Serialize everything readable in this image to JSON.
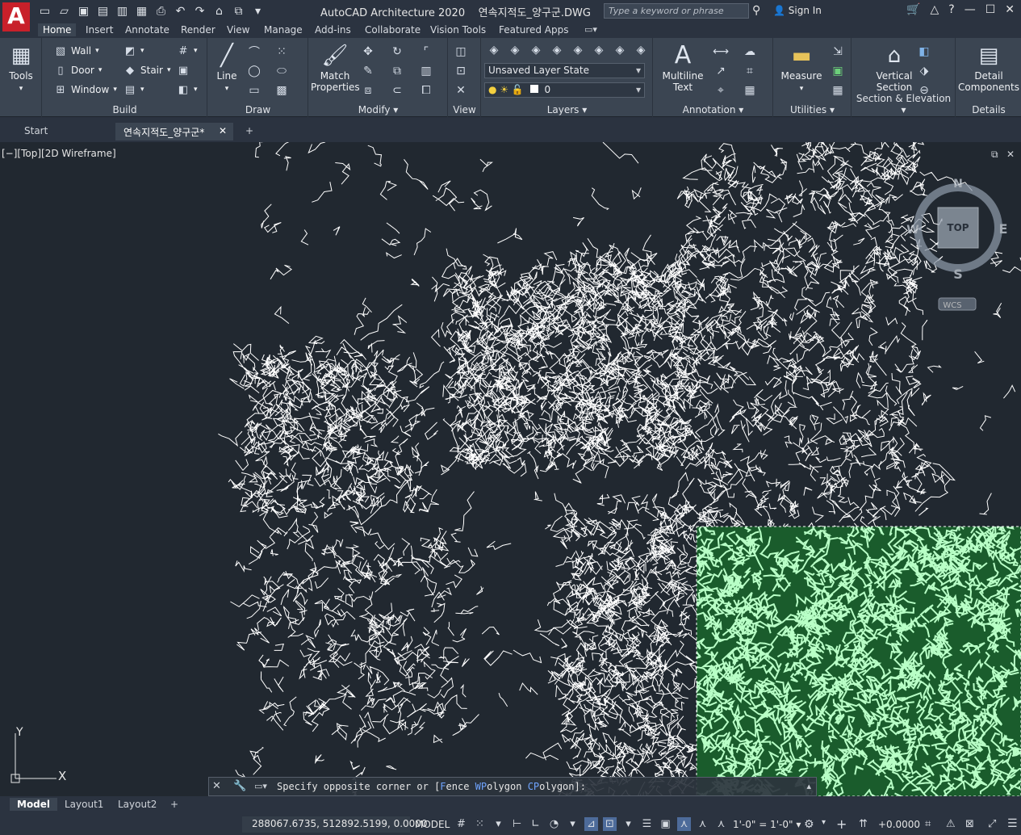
{
  "app": {
    "title": "AutoCAD Architecture 2020",
    "file": "연속지적도_양구군.DWG",
    "search_placeholder": "Type a keyword or phrase",
    "sign_in": "Sign In"
  },
  "ribbon_tabs": [
    "Home",
    "Insert",
    "Annotate",
    "Render",
    "View",
    "Manage",
    "Add-ins",
    "Collaborate",
    "Vision Tools",
    "Featured Apps"
  ],
  "panels": {
    "tools": {
      "label": "Tools"
    },
    "build": {
      "label": "Build",
      "wall": "Wall",
      "door": "Door",
      "window": "Window",
      "stair": "Stair"
    },
    "draw": {
      "label": "Draw",
      "line": "Line"
    },
    "modify": {
      "label": "Modify",
      "match": "Match",
      "properties": "Properties"
    },
    "view": {
      "label": "View"
    },
    "layers": {
      "label": "Layers",
      "state": "Unsaved Layer State",
      "current": "0"
    },
    "annotation": {
      "label": "Annotation",
      "multiline": "Multiline",
      "text": "Text"
    },
    "utilities": {
      "label": "Utilities",
      "measure": "Measure"
    },
    "section": {
      "label": "Section & Elevation",
      "vertical": "Vertical",
      "section": "Section"
    },
    "details": {
      "label": "Details",
      "detail": "Detail",
      "components": "Components"
    }
  },
  "doc_tabs": {
    "start": "Start",
    "active": "연속지적도_양구군*"
  },
  "viewport": {
    "label": "[−][Top][2D Wireframe]",
    "viewcube": {
      "top": "TOP",
      "n": "N",
      "s": "S",
      "e": "E",
      "w": "W",
      "wcs": "WCS"
    },
    "ucs": {
      "x": "X",
      "y": "Y"
    }
  },
  "command_line": {
    "prompt": "Specify opposite corner or [",
    "opt1_key": "F",
    "opt1_rest": "ence ",
    "opt2_key": "WP",
    "opt2_rest": "olygon ",
    "opt3_key": "CP",
    "opt3_rest": "olygon]:"
  },
  "layout_tabs": [
    "Model",
    "Layout1",
    "Layout2"
  ],
  "status": {
    "coords": "288067.6735, 512892.5199, 0.0000",
    "mode": "MODEL",
    "scale": "1'-0\" = 1'-0\"",
    "annotation_offset": "+0.0000"
  },
  "colors": {
    "background": "#212830",
    "ribbon": "#3b4552",
    "selection_fill": "#a8f7b8",
    "selection_dark": "#1a5c2c",
    "lines": "#ffffff",
    "autocad_red": "#c8202a"
  }
}
